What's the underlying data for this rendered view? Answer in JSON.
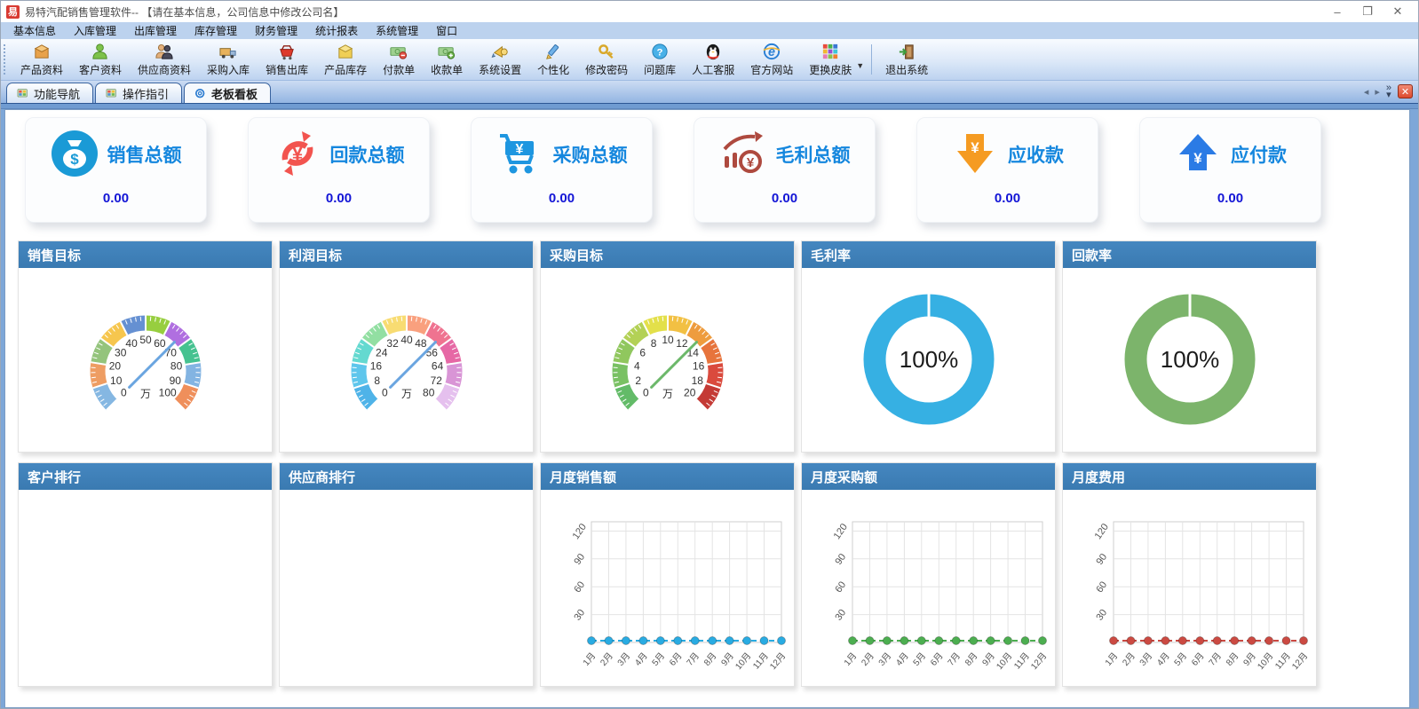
{
  "window": {
    "title": "易特汽配销售管理软件-- 【请在基本信息，公司信息中修改公司名】",
    "app_initial": "易",
    "controls": [
      {
        "name": "minimize-icon",
        "glyph": "–"
      },
      {
        "name": "maximize-icon",
        "glyph": "❐"
      },
      {
        "name": "close-icon",
        "glyph": "✕"
      }
    ]
  },
  "menu": {
    "items": [
      "基本信息",
      "入库管理",
      "出库管理",
      "库存管理",
      "财务管理",
      "统计报表",
      "系统管理",
      "窗口"
    ]
  },
  "toolbar": {
    "items": [
      {
        "label": "产品资料",
        "icon": "product-box-icon"
      },
      {
        "label": "客户资料",
        "icon": "customer-icon"
      },
      {
        "label": "供应商资料",
        "icon": "supplier-icon"
      },
      {
        "label": "采购入库",
        "icon": "purchase-truck-icon"
      },
      {
        "label": "销售出库",
        "icon": "sales-cart-icon"
      },
      {
        "label": "产品库存",
        "icon": "stock-box-icon"
      },
      {
        "label": "付款单",
        "icon": "payment-note-icon"
      },
      {
        "label": "收款单",
        "icon": "receipt-note-icon"
      },
      {
        "label": "系统设置",
        "icon": "system-settings-icon"
      },
      {
        "label": "个性化",
        "icon": "personalize-icon"
      },
      {
        "label": "修改密码",
        "icon": "password-key-icon"
      },
      {
        "label": "问题库",
        "icon": "question-icon"
      },
      {
        "label": "人工客服",
        "icon": "qq-service-icon"
      },
      {
        "label": "官方网站",
        "icon": "website-icon"
      },
      {
        "label": "更换皮肤",
        "icon": "skin-icon",
        "dropdown": true
      },
      {
        "label": "退出系统",
        "icon": "exit-icon",
        "separated": true
      }
    ]
  },
  "tabs": {
    "items": [
      {
        "label": "功能导航",
        "icon": "nav-map-icon",
        "active": false
      },
      {
        "label": "操作指引",
        "icon": "nav-map-icon",
        "active": false
      },
      {
        "label": "老板看板",
        "icon": "dashboard-icon",
        "active": true
      }
    ],
    "scroll_left": "◂",
    "scroll_right": "▸",
    "more": "»",
    "close": "✕"
  },
  "kpi_cards": [
    {
      "label": "销售总额",
      "value": "0.00",
      "icon": "money-bag-icon",
      "color": "#1a9ad6"
    },
    {
      "label": "回款总额",
      "value": "0.00",
      "icon": "refresh-yen-icon",
      "color": "#f2544f"
    },
    {
      "label": "采购总额",
      "value": "0.00",
      "icon": "cart-yen-icon",
      "color": "#1e96e0"
    },
    {
      "label": "毛利总额",
      "value": "0.00",
      "icon": "profit-chart-icon",
      "color": "#ae4a3f"
    },
    {
      "label": "应收款",
      "value": "0.00",
      "icon": "arrow-down-yen-icon",
      "color": "#f59b22"
    },
    {
      "label": "应付款",
      "value": "0.00",
      "icon": "arrow-up-yen-icon",
      "color": "#2b7be5"
    }
  ],
  "panels": [
    {
      "title": "销售目标",
      "chart": 0
    },
    {
      "title": "利润目标",
      "chart": 1
    },
    {
      "title": "采购目标",
      "chart": 2
    },
    {
      "title": "毛利率",
      "chart": 3
    },
    {
      "title": "回款率",
      "chart": 4
    },
    {
      "title": "客户排行",
      "chart": null
    },
    {
      "title": "供应商排行",
      "chart": null
    },
    {
      "title": "月度销售额",
      "chart": 5
    },
    {
      "title": "月度采购额",
      "chart": 6
    },
    {
      "title": "月度费用",
      "chart": 7
    }
  ],
  "chart_data": [
    {
      "type": "gauge",
      "title": "销售目标",
      "min": 0,
      "max": 100,
      "tick_step": 10,
      "unit": "万",
      "needle_angle_deg": 45,
      "needle_color": "#6aa5e0",
      "segment_colors": [
        "#85b7e2",
        "#ee9d63",
        "#94c47c",
        "#f6c64e",
        "#6590d2",
        "#97ce3f",
        "#b06fe0",
        "#46c290",
        "#83b4e2",
        "#ef8f5b"
      ]
    },
    {
      "type": "gauge",
      "title": "利润目标",
      "min": 0,
      "max": 80,
      "tick_step": 8,
      "unit": "万",
      "needle_angle_deg": 45,
      "needle_color": "#6aa5e0",
      "segment_colors": [
        "#4fb3e8",
        "#5ec6ec",
        "#64d9d0",
        "#92dfa2",
        "#f8dc72",
        "#f9a07e",
        "#ef7390",
        "#e668a5",
        "#d995d6",
        "#e5c0ee"
      ]
    },
    {
      "type": "gauge",
      "title": "采购目标",
      "min": 0,
      "max": 20,
      "tick_step": 2,
      "unit": "万",
      "needle_angle_deg": 45,
      "needle_color": "#6cb86a",
      "segment_colors": [
        "#63bb68",
        "#79c163",
        "#90c75e",
        "#b3d156",
        "#e3e04a",
        "#f2c043",
        "#ee9c3e",
        "#e7743c",
        "#da4a3d",
        "#c43a35"
      ]
    },
    {
      "type": "donut",
      "title": "毛利率",
      "value_pct": 100,
      "label": "100%",
      "color": "#36b0e3"
    },
    {
      "type": "donut",
      "title": "回款率",
      "value_pct": 100,
      "label": "100%",
      "color": "#7cb46b"
    },
    {
      "type": "line",
      "title": "月度销售额",
      "color": "#29abe2",
      "x_labels": [
        "1月",
        "2月",
        "3月",
        "4月",
        "5月",
        "6月",
        "7月",
        "8月",
        "9月",
        "10月",
        "11月",
        "12月"
      ],
      "values": [
        0,
        0,
        0,
        0,
        0,
        0,
        0,
        0,
        0,
        0,
        0,
        0
      ],
      "y_ticks": [
        30,
        60,
        90,
        120
      ],
      "y_max": 130
    },
    {
      "type": "line",
      "title": "月度采购额",
      "color": "#4cae50",
      "x_labels": [
        "1月",
        "2月",
        "3月",
        "4月",
        "5月",
        "6月",
        "7月",
        "8月",
        "9月",
        "10月",
        "11月",
        "12月"
      ],
      "values": [
        0,
        0,
        0,
        0,
        0,
        0,
        0,
        0,
        0,
        0,
        0,
        0
      ],
      "y_ticks": [
        30,
        60,
        90,
        120
      ],
      "y_max": 130
    },
    {
      "type": "line",
      "title": "月度费用",
      "color": "#cb4a42",
      "x_labels": [
        "1月",
        "2月",
        "3月",
        "4月",
        "5月",
        "6月",
        "7月",
        "8月",
        "9月",
        "10月",
        "11月",
        "12月"
      ],
      "values": [
        0,
        0,
        0,
        0,
        0,
        0,
        0,
        0,
        0,
        0,
        0,
        0
      ],
      "y_ticks": [
        30,
        60,
        90,
        120
      ],
      "y_max": 130
    }
  ]
}
